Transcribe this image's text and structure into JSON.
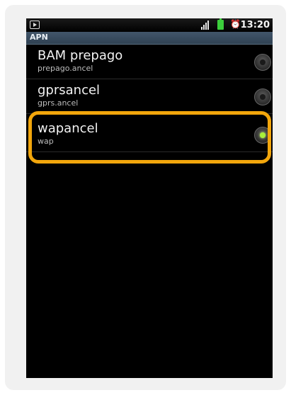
{
  "status_bar": {
    "time": "13:20",
    "left_icon": "media-icon",
    "signal_icon": "signal-icon",
    "battery_icon": "battery-icon",
    "alarm_icon": "alarm-icon",
    "alarm_glyph": "⏰"
  },
  "header": {
    "title": "APN"
  },
  "apn_list": [
    {
      "name": "BAM prepago",
      "value": "prepago.ancel",
      "selected": false
    },
    {
      "name": "gprsancel",
      "value": "gprs.ancel",
      "selected": false
    },
    {
      "name": "wapancel",
      "value": "wap",
      "selected": true
    }
  ],
  "colors": {
    "highlight": "#f2a60c",
    "radio_checked": "#a8f03a",
    "title_bar": "#3a4d60"
  }
}
